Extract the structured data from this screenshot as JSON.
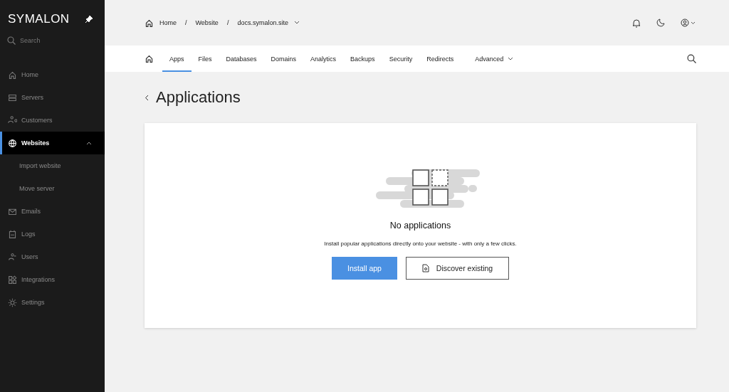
{
  "sidebar": {
    "logo": "SYMALON",
    "search": {
      "placeholder": "Search"
    },
    "items": [
      {
        "label": "Home",
        "kind": "item",
        "selected": false,
        "expanded": false
      },
      {
        "label": "Servers",
        "kind": "item",
        "selected": false,
        "expanded": false
      },
      {
        "label": "Customers",
        "kind": "item",
        "selected": false,
        "expanded": false
      },
      {
        "label": "Websites",
        "kind": "item",
        "selected": true,
        "expanded": true
      },
      {
        "label": "Import website",
        "kind": "subitem",
        "selected": false,
        "expanded": false
      },
      {
        "label": "Move server",
        "kind": "subitem",
        "selected": false,
        "expanded": false
      },
      {
        "label": "Emails",
        "kind": "item",
        "selected": false,
        "expanded": false
      },
      {
        "label": "Logs",
        "kind": "item",
        "selected": false,
        "expanded": false
      },
      {
        "label": "Users",
        "kind": "item",
        "selected": false,
        "expanded": false
      },
      {
        "label": "Integrations",
        "kind": "item",
        "selected": false,
        "expanded": false
      },
      {
        "label": "Settings",
        "kind": "item",
        "selected": false,
        "expanded": false
      }
    ]
  },
  "breadcrumb": {
    "separator": "/",
    "items": [
      "Home",
      "Website",
      "docs.symalon.site"
    ]
  },
  "tabs": [
    {
      "label": "Apps",
      "selected": true
    },
    {
      "label": "Files",
      "selected": false
    },
    {
      "label": "Databases",
      "selected": false
    },
    {
      "label": "Domains",
      "selected": false
    },
    {
      "label": "Analytics",
      "selected": false
    },
    {
      "label": "Backups",
      "selected": false
    },
    {
      "label": "Security",
      "selected": false
    },
    {
      "label": "Redirects",
      "selected": false
    },
    {
      "label": "Advanced",
      "selected": false,
      "dropdown": true
    }
  ],
  "page_title": "Applications",
  "empty_state": {
    "title": "No applications",
    "text": "Install popular applications directly onto your website - with only a few clicks.",
    "buttons": [
      {
        "label": "Install app",
        "kind": "primary"
      },
      {
        "label": "Discover existing",
        "kind": "secondary"
      }
    ]
  }
}
